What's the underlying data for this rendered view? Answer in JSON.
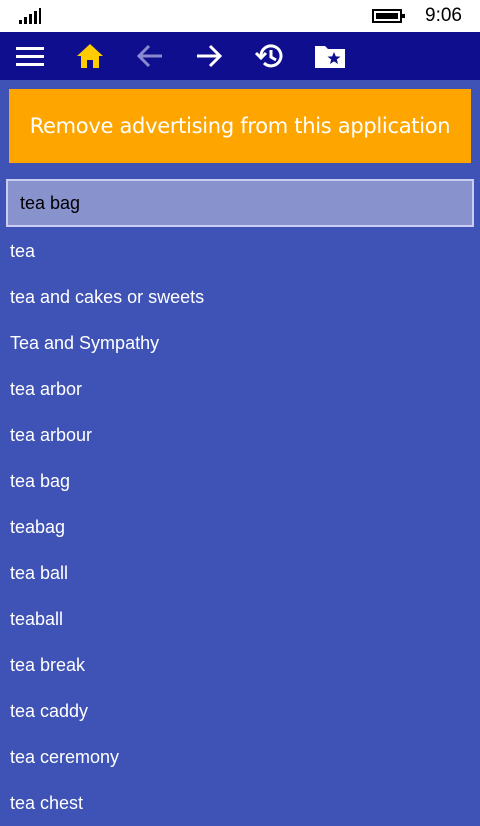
{
  "status_bar": {
    "time": "9:06",
    "icons": [
      "signal-strength-icon",
      "battery-icon"
    ]
  },
  "toolbar": {
    "buttons": [
      {
        "name": "menu-button",
        "icon": "hamburger-menu-icon"
      },
      {
        "name": "home-button",
        "icon": "home-icon",
        "color": "#ffcc00"
      },
      {
        "name": "back-button",
        "icon": "arrow-left-icon",
        "color": "#8a8ad0"
      },
      {
        "name": "forward-button",
        "icon": "arrow-right-icon"
      },
      {
        "name": "history-button",
        "icon": "history-icon"
      },
      {
        "name": "favorites-button",
        "icon": "star-folder-icon"
      }
    ],
    "background": "#0e0e8f"
  },
  "ad_banner": {
    "label": "Remove advertising from this application",
    "background": "#ffa500"
  },
  "search": {
    "value": "tea bag",
    "placeholder": ""
  },
  "results": [
    "tea",
    "tea and cakes or sweets",
    "Tea and Sympathy",
    "tea arbor",
    "tea arbour",
    "tea bag",
    "teabag",
    "tea ball",
    "teaball",
    "tea break",
    "tea caddy",
    "tea ceremony",
    "tea chest"
  ],
  "colors": {
    "page_background": "#3f53b6",
    "search_background": "#8892cc",
    "text": "#ffffff"
  }
}
